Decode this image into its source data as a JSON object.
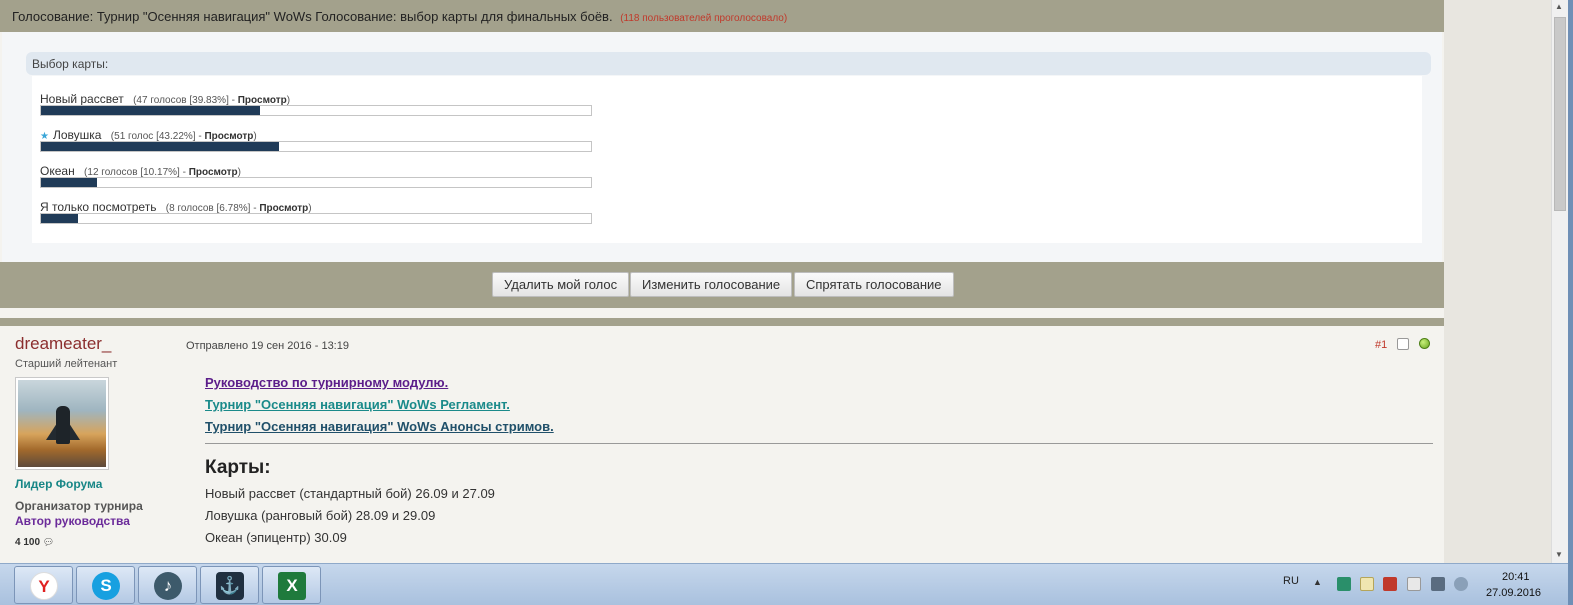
{
  "poll": {
    "title": "Голосование: Турнир \"Осенняя навигация\" WoWs Голосование: выбор карты для финальных боёв.",
    "voters": "(118 пользователей проголосовало)",
    "question": "Выбор карты:",
    "choices": [
      {
        "label": "Новый рассвет",
        "votes_text": "(47 голосов [39.83%] - ",
        "view": "Просмотр",
        "close": ")",
        "percent": 39.83,
        "voted": false
      },
      {
        "label": "Ловушка",
        "votes_text": "(51 голос [43.22%] - ",
        "view": "Просмотр",
        "close": ")",
        "percent": 43.22,
        "voted": true
      },
      {
        "label": "Океан",
        "votes_text": "(12 голосов [10.17%] - ",
        "view": "Просмотр",
        "close": ")",
        "percent": 10.17,
        "voted": false
      },
      {
        "label": "Я только посмотреть",
        "votes_text": "(8 голосов [6.78%] - ",
        "view": "Просмотр",
        "close": ")",
        "percent": 6.78,
        "voted": false
      }
    ],
    "buttons": {
      "delete_vote": "Удалить мой голос",
      "change_vote": "Изменить голосование",
      "hide_poll": "Спрятать голосование"
    }
  },
  "post": {
    "author": "dreameater_",
    "rank": "Старший лейтенант",
    "group": "Лидер Форума",
    "org_title": "Организатор турнира",
    "guide_title": "Автор руководства",
    "post_count": "4 100",
    "sent": "Отправлено 19 сен 2016 - 13:19",
    "number": "#1",
    "links": [
      "Руководство по турнирному модулю.",
      "Турнир \"Осенняя навигация\" WoWs Регламент.",
      "Турнир \"Осенняя навигация\" WoWs Анонсы стримов."
    ],
    "maps_heading": "Карты:",
    "maps": [
      "Новый рассвет (стандартный бой) 26.09 и 27.09",
      "Ловушка (ранговый бой) 28.09 и 29.09",
      "Океан (эпицентр) 30.09"
    ]
  },
  "taskbar": {
    "apps": [
      "yandex-browser-icon",
      "skype-icon",
      "media-player-icon",
      "world-of-warships-icon",
      "excel-icon"
    ],
    "app_glyphs": [
      "Y",
      "S",
      "♪",
      "⚓",
      "X"
    ],
    "lang": "RU",
    "time": "20:41",
    "date": "27.09.2016"
  },
  "colors": {
    "header_bg": "#a3a18c",
    "bar_fill": "#203b58",
    "author": "#8b2e2e",
    "leader": "#178686"
  }
}
